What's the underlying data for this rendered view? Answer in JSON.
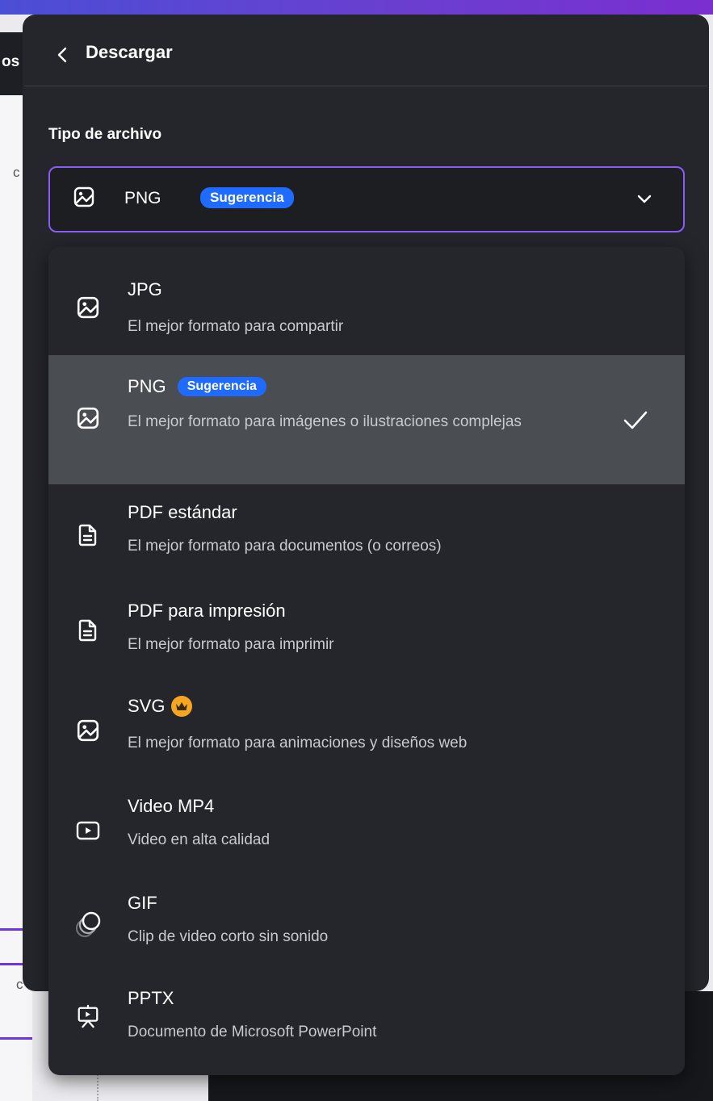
{
  "background": {
    "toolbar_fragment": "os",
    "canvas_fragment_1": "c",
    "canvas_fragment_2": "c"
  },
  "panel": {
    "back_icon": "chevron-left-icon",
    "title": "Descargar",
    "field_label": "Tipo de archivo",
    "select": {
      "icon": "image-icon",
      "value": "PNG",
      "badge": "Sugerencia",
      "chevron_icon": "chevron-down-icon"
    }
  },
  "dropdown": {
    "options": [
      {
        "title": "JPG",
        "description": "El mejor formato para compartir",
        "icon": "image-icon",
        "selected": false
      },
      {
        "title": "PNG",
        "badge": "Sugerencia",
        "description": "El mejor formato para imágenes o ilustraciones complejas",
        "icon": "image-icon",
        "selected": true,
        "check_icon": "check-icon"
      },
      {
        "title": "PDF estándar",
        "description": "El mejor formato para documentos (o correos)",
        "icon": "document-icon",
        "selected": false
      },
      {
        "title": "PDF para impresión",
        "description": "El mejor formato para imprimir",
        "icon": "document-icon",
        "selected": false
      },
      {
        "title": "SVG",
        "premium_icon": "crown-icon",
        "description": "El mejor formato para animaciones y diseños web",
        "icon": "image-icon",
        "selected": false
      },
      {
        "title": "Video MP4",
        "description": "Video en alta calidad",
        "icon": "video-icon",
        "selected": false
      },
      {
        "title": "GIF",
        "description": "Clip de video corto sin sonido",
        "icon": "gif-icon",
        "selected": false
      },
      {
        "title": "PPTX",
        "description": "Documento de Microsoft PowerPoint",
        "icon": "presentation-icon",
        "selected": false
      }
    ]
  },
  "colors": {
    "panel_bg": "#25262b",
    "selected_bg": "#4a4d52",
    "accent_border": "#8b5cf6",
    "badge_bg": "#1f6bff",
    "crown": "#f5a623"
  }
}
